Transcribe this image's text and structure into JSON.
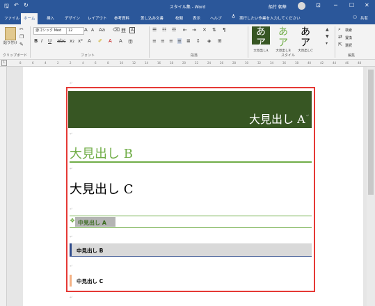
{
  "titlebar": {
    "title": "スタイル集 - Word",
    "user": "船竹 朝華",
    "quick_access": [
      "🖫",
      "↶",
      "↻"
    ],
    "win_min": "─",
    "win_max": "☐",
    "win_close": "✕",
    "ribbon_opts": "⊡"
  },
  "tabs": [
    "ファイル",
    "ホーム",
    "挿入",
    "デザイン",
    "レイアウト",
    "参考資料",
    "差し込み文書",
    "校閲",
    "表示",
    "ヘルプ"
  ],
  "tell_me": "実行したい作業を入力してください",
  "share": "共有",
  "ribbon": {
    "clipboard": {
      "paste": "貼り付け",
      "label": "クリップボード"
    },
    "font": {
      "name": "游ゴシック Med",
      "size": "12",
      "label": "フォント"
    },
    "paragraph": {
      "label": "段落"
    },
    "styles": {
      "label": "スタイル",
      "items": [
        {
          "glyph": "あア",
          "name": "大見出しA"
        },
        {
          "glyph": "あア",
          "name": "大見出しB"
        },
        {
          "glyph": "あア",
          "name": "大見出しC"
        }
      ]
    },
    "editing": {
      "find": "検索",
      "replace": "置換",
      "select": "選択",
      "label": "編集"
    }
  },
  "ruler_numbers": [
    "8",
    "6",
    "4",
    "2",
    "2",
    "4",
    "6",
    "8",
    "10",
    "12",
    "14",
    "16",
    "18",
    "20",
    "22",
    "24",
    "26",
    "28",
    "30",
    "32",
    "34",
    "36",
    "38",
    "40",
    "42",
    "44",
    "46",
    "48"
  ],
  "document": {
    "para_mark": "↵",
    "heading_large_a": "大見出し A",
    "heading_large_b": "大見出し B",
    "heading_large_c": "大見出し C",
    "heading_mid_a": "中見出し A",
    "heading_mid_b": "中見出し B",
    "heading_mid_c": "中見出し C",
    "diamond": "❖"
  },
  "colors": {
    "ribbon_blue": "#2b579a",
    "dark_green": "#375623",
    "green": "#70ad47",
    "navy": "#2e4a8a",
    "peach": "#f4b183",
    "highlight_red": "#e53935"
  }
}
